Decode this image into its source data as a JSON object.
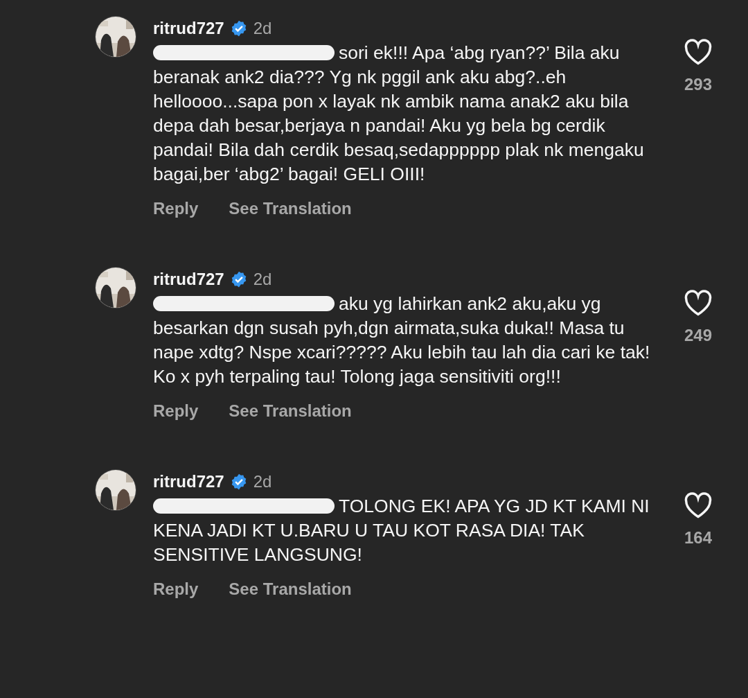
{
  "comments": [
    {
      "username": "ritrud727",
      "verified": true,
      "time": "2d",
      "redacted_mention": true,
      "text": "sori ek!!! Apa ‘abg ryan??’ Bila aku beranak ank2 dia??? Yg nk pggil ank aku abg?..eh helloooo...sapa pon x layak nk ambik nama anak2 aku bila depa dah besar,berjaya n pandai! Aku yg bela bg cerdik pandai! Bila dah cerdik besaq,sedapppppp plak nk mengaku bagai,ber ‘abg2’ bagai! GELI OIII!",
      "likes": "293",
      "liked": false,
      "actions": [
        "Reply",
        "See Translation"
      ]
    },
    {
      "username": "ritrud727",
      "verified": true,
      "time": "2d",
      "redacted_mention": true,
      "text": "aku yg lahirkan ank2 aku,aku yg besarkan dgn susah pyh,dgn airmata,suka duka!! Masa tu nape xdtg? Nspe xcari????? Aku lebih tau lah dia cari ke tak! Ko x pyh terpaling tau! Tolong jaga sensitiviti org!!!",
      "likes": "249",
      "liked": false,
      "actions": [
        "Reply",
        "See Translation"
      ]
    },
    {
      "username": "ritrud727",
      "verified": true,
      "time": "2d",
      "redacted_mention": true,
      "text": "TOLONG EK! APA YG JD KT KAMI NI KENA JADI KT U.BARU U TAU KOT RASA DIA! TAK SENSITIVE LANGSUNG!",
      "likes": "164",
      "liked": false,
      "actions": [
        "Reply",
        "See Translation"
      ]
    }
  ]
}
